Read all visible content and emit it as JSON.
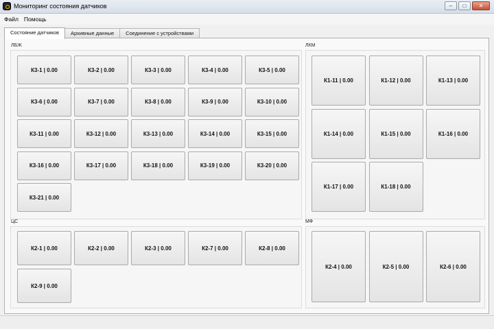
{
  "window": {
    "title": "Мониторинг состояния датчиков",
    "controls": [
      "–",
      "□",
      "✕"
    ]
  },
  "menu": [
    "Файл",
    "Помощь"
  ],
  "tabs": [
    "Состояние датчиков",
    "Архивные данные",
    "Соединение с устройствами"
  ],
  "active_tab": 0,
  "groups": [
    {
      "title": "ЛБЖ",
      "sensors": [
        "К3-1 | 0.00",
        "К3-2 | 0.00",
        "К3-3 | 0.00",
        "К3-4 | 0.00",
        "К3-5 | 0.00",
        "К3-6 | 0.00",
        "К3-7 | 0.00",
        "К3-8 | 0.00",
        "К3-9 | 0.00",
        "К3-10 | 0.00",
        "К3-11 | 0.00",
        "К3-12 | 0.00",
        "К3-13 | 0.00",
        "К3-14 | 0.00",
        "К3-15 | 0.00",
        "К3-16 | 0.00",
        "К3-17 | 0.00",
        "К3-18 | 0.00",
        "К3-19 | 0.00",
        "К3-20 | 0.00",
        "К3-21 | 0.00"
      ]
    },
    {
      "title": "ЛКМ",
      "sensors": [
        "К1-11 | 0.00",
        "К1-12 | 0.00",
        "К1-13 | 0.00",
        "К1-14 | 0.00",
        "К1-15 | 0.00",
        "К1-16 | 0.00",
        "К1-17 | 0.00",
        "К1-18 | 0.00"
      ]
    },
    {
      "title": "ЦС",
      "sensors": [
        "К2-1 | 0.00",
        "К2-2 | 0.00",
        "К2-3 | 0.00",
        "К2-7 | 0.00",
        "К2-8 | 0.00",
        "К2-9 | 0.00"
      ]
    },
    {
      "title": "МФ",
      "sensors": [
        "К2-4 | 0.00",
        "К2-5 | 0.00",
        "К2-6 | 0.00"
      ]
    }
  ]
}
